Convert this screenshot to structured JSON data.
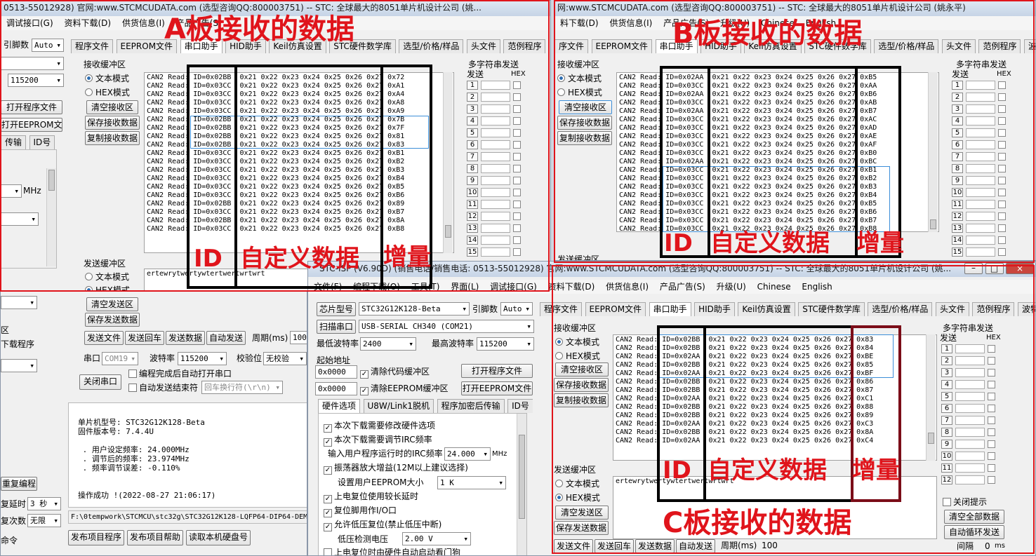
{
  "window_a": {
    "title": "0513-55012928) 官网:www.STCMCUDATA.com  (选型咨询QQ:800003751) -- STC: 全球最大的8051单片机设计公司 (姚...",
    "menu": [
      "调试接口(G)",
      "资料下载(D)",
      "供货信息(I)",
      "产品广告(S)"
    ],
    "left": {
      "ref_pin_label": "引脚数",
      "ref_pin_value": "Auto",
      "baud_value": "115200",
      "open_prog_btn": "打开程序文件",
      "open_eeprom_btn": "打开EEPROM文件",
      "tab_transfer": "传输",
      "tab_id": "ID号",
      "mhz": "MHz",
      "hint": "区",
      "download_prog": "下载程序"
    },
    "tabs": [
      "程序文件",
      "EEPROM文件",
      "串口助手",
      "HID助手",
      "Keil仿真设置",
      "STC硬件数学库",
      "选型/价格/样品",
      "头文件",
      "范例程序",
      "波特"
    ],
    "recv_title": "接收缓冲区",
    "text_mode": "文本模式",
    "hex_mode": "HEX模式",
    "btn_clear_recv": "清空接收区",
    "btn_save_recv": "保存接收数据",
    "btn_copy_recv": "复制接收数据",
    "log": [
      "CAN2 Read: ID=0x02BB  0x21 0x22 0x23 0x24 0x25 0x26 0x27 0x72",
      "CAN2 Read: ID=0x03CC  0x21 0x22 0x23 0x24 0x25 0x26 0x27 0xA1",
      "CAN2 Read: ID=0x03CC  0x21 0x22 0x23 0x24 0x25 0x26 0x27 0xA4",
      "CAN2 Read: ID=0x03CC  0x21 0x22 0x23 0x24 0x25 0x26 0x27 0xA8",
      "CAN2 Read: ID=0x03CC  0x21 0x22 0x23 0x24 0x25 0x26 0x27 0xA9",
      "CAN2 Read: ID=0x02BB  0x21 0x22 0x23 0x24 0x25 0x26 0x27 0x7B",
      "CAN2 Read: ID=0x02BB  0x21 0x22 0x23 0x24 0x25 0x26 0x27 0x7F",
      "CAN2 Read: ID=0x02BB  0x21 0x22 0x23 0x24 0x25 0x26 0x27 0x81",
      "CAN2 Read: ID=0x02BB  0x21 0x22 0x23 0x24 0x25 0x26 0x27 0x83",
      "CAN2 Read: ID=0x03CC  0x21 0x22 0x23 0x24 0x25 0x26 0x27 0xB1",
      "CAN2 Read: ID=0x03CC  0x21 0x22 0x23 0x24 0x25 0x26 0x27 0xB2",
      "CAN2 Read: ID=0x03CC  0x21 0x22 0x23 0x24 0x25 0x26 0x27 0xB3",
      "CAN2 Read: ID=0x03CC  0x21 0x22 0x23 0x24 0x25 0x26 0x27 0xB4",
      "CAN2 Read: ID=0x03CC  0x21 0x22 0x23 0x24 0x25 0x26 0x27 0xB5",
      "CAN2 Read: ID=0x03CC  0x21 0x22 0x23 0x24 0x25 0x26 0x27 0xB6",
      "CAN2 Read: ID=0x02BB  0x21 0x22 0x23 0x24 0x25 0x26 0x27 0x89",
      "CAN2 Read: ID=0x03CC  0x21 0x22 0x23 0x24 0x25 0x26 0x27 0xB7",
      "CAN2 Read: ID=0x02BB  0x21 0x22 0x23 0x24 0x25 0x26 0x27 0x8A",
      "CAN2 Read: ID=0x03CC  0x21 0x22 0x23 0x24 0x25 0x26 0x27 0xB8"
    ],
    "multi_title": "多字符串发送",
    "send_col": "发送",
    "hex_col": "HEX",
    "multi_rows": [
      "1",
      "2",
      "3",
      "4",
      "5",
      "6",
      "7",
      "8",
      "9",
      "10",
      "11",
      "12",
      "13",
      "14",
      "15"
    ],
    "send_title": "发送缓冲区",
    "send_text": "ertewrytwertywtertwertwrtwrt",
    "btn_clear_send": "清空发送区",
    "btn_save_send": "保存发送数据",
    "btn_send_file": "发送文件",
    "btn_send_cr": "发送回车",
    "btn_send_data": "发送数据",
    "btn_auto_send": "自动发送",
    "period_label": "周期(ms)",
    "period_value": "100",
    "port_label": "串口",
    "port_value": "COM19",
    "baud_label": "波特率",
    "baud2_value": "115200",
    "parity_label": "校验位",
    "parity_value": "无校验",
    "btn_close_port": "关闭串口",
    "opt_auto_open": "编程完成后自动打开串口",
    "opt_auto_send_end": "自动发送结束符",
    "end_char": "回车换行符(\\r\\n)",
    "info_lines": [
      "单片机型号: STC32G12K128-Beta",
      "固件版本号: 7.4.4U",
      "",
      " . 用户设定频率: 24.000MHz",
      " . 调节后的频率: 23.974MHz",
      " . 频率调节误差: -0.110%",
      "",
      "",
      "操作成功 !(2022-08-27 21:06:17)"
    ],
    "path": "F:\\0tempwork\\STCMCU\\stc32g\\STC32G12K128-LQFP64-DIP64-DEM",
    "btn_publish_prog": "发布项目程序",
    "btn_publish_help": "发布项目帮助",
    "btn_read_disk": "读取本机硬盘号",
    "re_prog": "重复编程",
    "re_delay": "复延时",
    "re_delay_val": "3 秒",
    "re_count": "复次数",
    "re_count_val": "无限",
    "cmd": "命令"
  },
  "window_b": {
    "title": "网:www.STCMCUDATA.com  (选型咨询QQ:800003751) -- STC: 全球最大的8051单片机设计公司 (姚永平)",
    "menu": [
      "料下载(D)",
      "供货信息(I)",
      "产品广告(S)",
      "升级(U)",
      "Chinese",
      "English"
    ],
    "tabs": [
      "序文件",
      "EEPROM文件",
      "串口助手",
      "HID助手",
      "Keil仿真设置",
      "STC硬件数学库",
      "选型/价格/样品",
      "头文件",
      "范例程序",
      "波特率"
    ],
    "log": [
      "CAN2 Read: ID=0x02AA  0x21 0x22 0x23 0x24 0x25 0x26 0x27 0xB5",
      "CAN2 Read: ID=0x03CC  0x21 0x22 0x23 0x24 0x25 0x26 0x27 0xAA",
      "CAN2 Read: ID=0x02AA  0x21 0x22 0x23 0x24 0x25 0x26 0x27 0xB6",
      "CAN2 Read: ID=0x03CC  0x21 0x22 0x23 0x24 0x25 0x26 0x27 0xAB",
      "CAN2 Read: ID=0x02AA  0x21 0x22 0x23 0x24 0x25 0x26 0x27 0xB7",
      "CAN2 Read: ID=0x03CC  0x21 0x22 0x23 0x24 0x25 0x26 0x27 0xAC",
      "CAN2 Read: ID=0x03CC  0x21 0x22 0x23 0x24 0x25 0x26 0x27 0xAD",
      "CAN2 Read: ID=0x03CC  0x21 0x22 0x23 0x24 0x25 0x26 0x27 0xAE",
      "CAN2 Read: ID=0x03CC  0x21 0x22 0x23 0x24 0x25 0x26 0x27 0xAF",
      "CAN2 Read: ID=0x03CC  0x21 0x22 0x23 0x24 0x25 0x26 0x27 0xB0",
      "CAN2 Read: ID=0x02AA  0x21 0x22 0x23 0x24 0x25 0x26 0x27 0xBC",
      "CAN2 Read: ID=0x03CC  0x21 0x22 0x23 0x24 0x25 0x26 0x27 0xB1",
      "CAN2 Read: ID=0x03CC  0x21 0x22 0x23 0x24 0x25 0x26 0x27 0xB2",
      "CAN2 Read: ID=0x03CC  0x21 0x22 0x23 0x24 0x25 0x26 0x27 0xB3",
      "CAN2 Read: ID=0x03CC  0x21 0x22 0x23 0x24 0x25 0x26 0x27 0xB4",
      "CAN2 Read: ID=0x03CC  0x21 0x22 0x23 0x24 0x25 0x26 0x27 0xB5",
      "CAN2 Read: ID=0x03CC  0x21 0x22 0x23 0x24 0x25 0x26 0x27 0xB6",
      "CAN2 Read: ID=0x03CC  0x21 0x22 0x23 0x24 0x25 0x26 0x27 0xB7",
      "CAN2 Read: ID=0x03CC  0x21 0x22 0x23 0x24 0x25 0x26 0x27 0xB8"
    ],
    "send_title_partial": "发送缓冲区"
  },
  "window_c": {
    "title": "STC-ISP (V6.90D) (销售电话/销售电话: 0513-55012928) 官网:www.STCMCUDATA.com  (选型咨询QQ:800003751) -- STC: 全球最大的8051单片机设计公司 (姚...",
    "menu": [
      "文件(F)",
      "编程下载(O)",
      "工具(T)",
      "界面(L)",
      "调试接口(G)",
      "资料下载(D)",
      "供货信息(I)",
      "产品广告(S)",
      "升级(U)",
      "Chinese",
      "English"
    ],
    "chip_label": "芯片型号",
    "chip_value": "STC32G12K128-Beta",
    "pin_label": "引脚数",
    "pin_value": "Auto",
    "scan_btn": "扫描串口",
    "port_value": "USB-SERIAL CH340 (COM21)",
    "min_baud_label": "最低波特率",
    "min_baud": "2400",
    "max_baud_label": "最高波特率",
    "max_baud": "115200",
    "start_addr": "起始地址",
    "addr1": "0x0000",
    "clr_code": "清除代码缓冲区",
    "open_prog": "打开程序文件",
    "addr2": "0x0000",
    "clr_eeprom": "清除EEPROM缓冲区",
    "open_eeprom": "打开EEPROM文件",
    "hw_tabs": [
      "硬件选项",
      "U8W/Link1脱机",
      "程序加密后传输",
      "ID号"
    ],
    "hw_opts": [
      {
        "label": "本次下载需要修改硬件选项"
      },
      {
        "label": "本次下载需要调节IRC频率"
      },
      {
        "label": "输入用户程序运行时的IRC频率",
        "value": "24.000",
        "unit": "MHz"
      },
      {
        "label": "振荡器放大增益(12M以上建议选择)"
      },
      {
        "label": "设置用户EEPROM大小",
        "value": "1    K"
      },
      {
        "label": "上电复位使用较长延时"
      },
      {
        "label": "复位脚用作I/O口"
      },
      {
        "label": "允许低压复位(禁止低压中断)"
      },
      {
        "label": "低压检测电压",
        "value": "2.00 V"
      },
      {
        "label": "上电复位时由硬件自动启动看门狗"
      }
    ],
    "tabs": [
      "程序文件",
      "EEPROM文件",
      "串口助手",
      "HID助手",
      "Keil仿真设置",
      "STC硬件数学库",
      "选型/价格/样品",
      "头文件",
      "范例程序",
      "波特"
    ],
    "log": [
      "CAN2 Read: ID=0x02BB  0x21 0x22 0x23 0x24 0x25 0x26 0x27 0x83",
      "CAN2 Read: ID=0x02BB  0x21 0x22 0x23 0x24 0x25 0x26 0x27 0x84",
      "CAN2 Read: ID=0x02AA  0x21 0x22 0x23 0x24 0x25 0x26 0x27 0xBE",
      "CAN2 Read: ID=0x02BB  0x21 0x22 0x23 0x24 0x25 0x26 0x27 0x85",
      "CAN2 Read: ID=0x02AA  0x21 0x22 0x23 0x24 0x25 0x26 0x27 0xBF",
      "CAN2 Read: ID=0x02BB  0x21 0x22 0x23 0x24 0x25 0x26 0x27 0x86",
      "CAN2 Read: ID=0x02BB  0x21 0x22 0x23 0x24 0x25 0x26 0x27 0x87",
      "CAN2 Read: ID=0x02AA  0x21 0x22 0x23 0x24 0x25 0x26 0x27 0xC1",
      "CAN2 Read: ID=0x02BB  0x21 0x22 0x23 0x24 0x25 0x26 0x27 0x88",
      "CAN2 Read: ID=0x02BB  0x21 0x22 0x23 0x24 0x25 0x26 0x27 0x89",
      "CAN2 Read: ID=0x02AA  0x21 0x22 0x23 0x24 0x25 0x26 0x27 0xC3",
      "CAN2 Read: ID=0x02BB  0x21 0x22 0x23 0x24 0x25 0x26 0x27 0x8A",
      "CAN2 Read: ID=0x02AA  0x21 0x22 0x23 0x24 0x25 0x26 0x27 0xC4"
    ],
    "multi_rows": [
      "1",
      "2",
      "3",
      "4",
      "5",
      "6",
      "7",
      "8",
      "9",
      "10",
      "11",
      "12"
    ],
    "close_hint": "关闭提示",
    "clear_all": "清空全部数据",
    "auto_loop": "自动循环发送",
    "interval_label": "间隔",
    "interval_value": "0",
    "interval_unit": "ms"
  },
  "annotations": {
    "a_title": "A板接收的数据",
    "b_title": "B板接收的数据",
    "c_title": "C板接收的数据",
    "id": "ID",
    "custom": "自定义数据",
    "inc": "增量"
  }
}
